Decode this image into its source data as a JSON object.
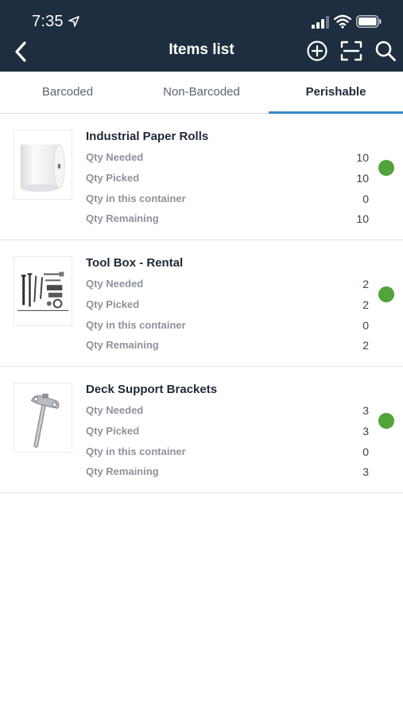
{
  "status_bar": {
    "time": "7:35"
  },
  "nav": {
    "title": "Items list"
  },
  "tabs": [
    {
      "label": "Barcoded",
      "active": false
    },
    {
      "label": "Non-Barcoded",
      "active": false
    },
    {
      "label": "Perishable",
      "active": true
    }
  ],
  "labels": {
    "qty_needed": "Qty Needed",
    "qty_picked": "Qty Picked",
    "qty_container": "Qty in this container",
    "qty_remaining": "Qty Remaining"
  },
  "items": [
    {
      "name": "Industrial Paper Rolls",
      "qty_needed": "10",
      "qty_picked": "10",
      "qty_container": "0",
      "qty_remaining": "10",
      "image_icon": "paper-roll-icon",
      "status_color": "#52a33a"
    },
    {
      "name": "Tool Box - Rental",
      "qty_needed": "2",
      "qty_picked": "2",
      "qty_container": "0",
      "qty_remaining": "2",
      "image_icon": "screws-bolts-icon",
      "status_color": "#52a33a"
    },
    {
      "name": "Deck Support Brackets",
      "qty_needed": "3",
      "qty_picked": "3",
      "qty_container": "0",
      "qty_remaining": "3",
      "image_icon": "bracket-pin-icon",
      "status_color": "#52a33a"
    }
  ],
  "colors": {
    "header_bg": "#1e2d40",
    "accent": "#3a86c8",
    "status_ok": "#52a33a"
  }
}
